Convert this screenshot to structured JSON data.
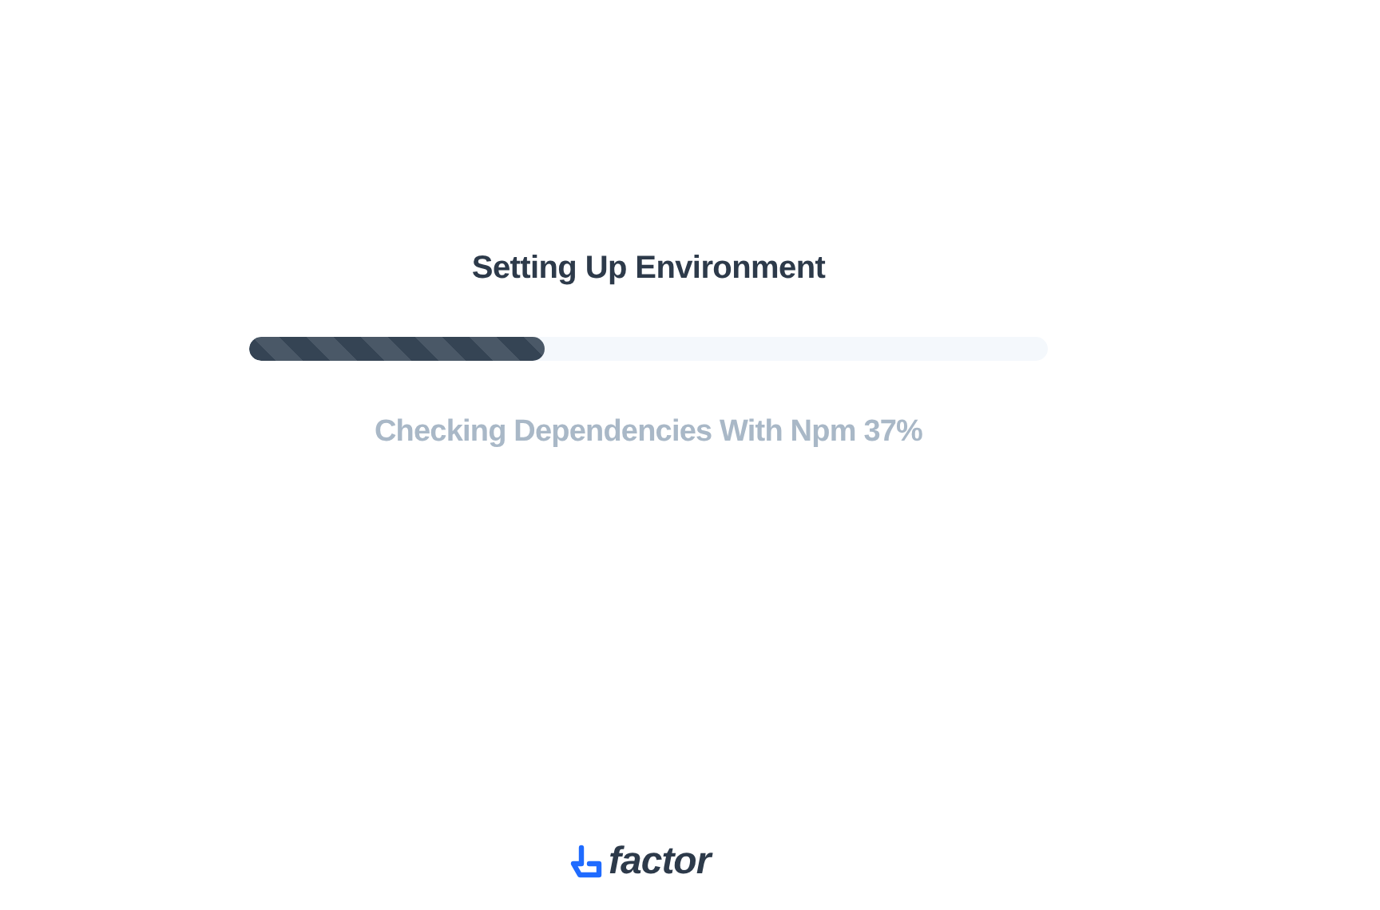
{
  "title": "Setting Up Environment",
  "progress": {
    "level": 0.37
  },
  "status": "Checking Dependencies With Npm 37%",
  "logo": {
    "text": "factor"
  }
}
